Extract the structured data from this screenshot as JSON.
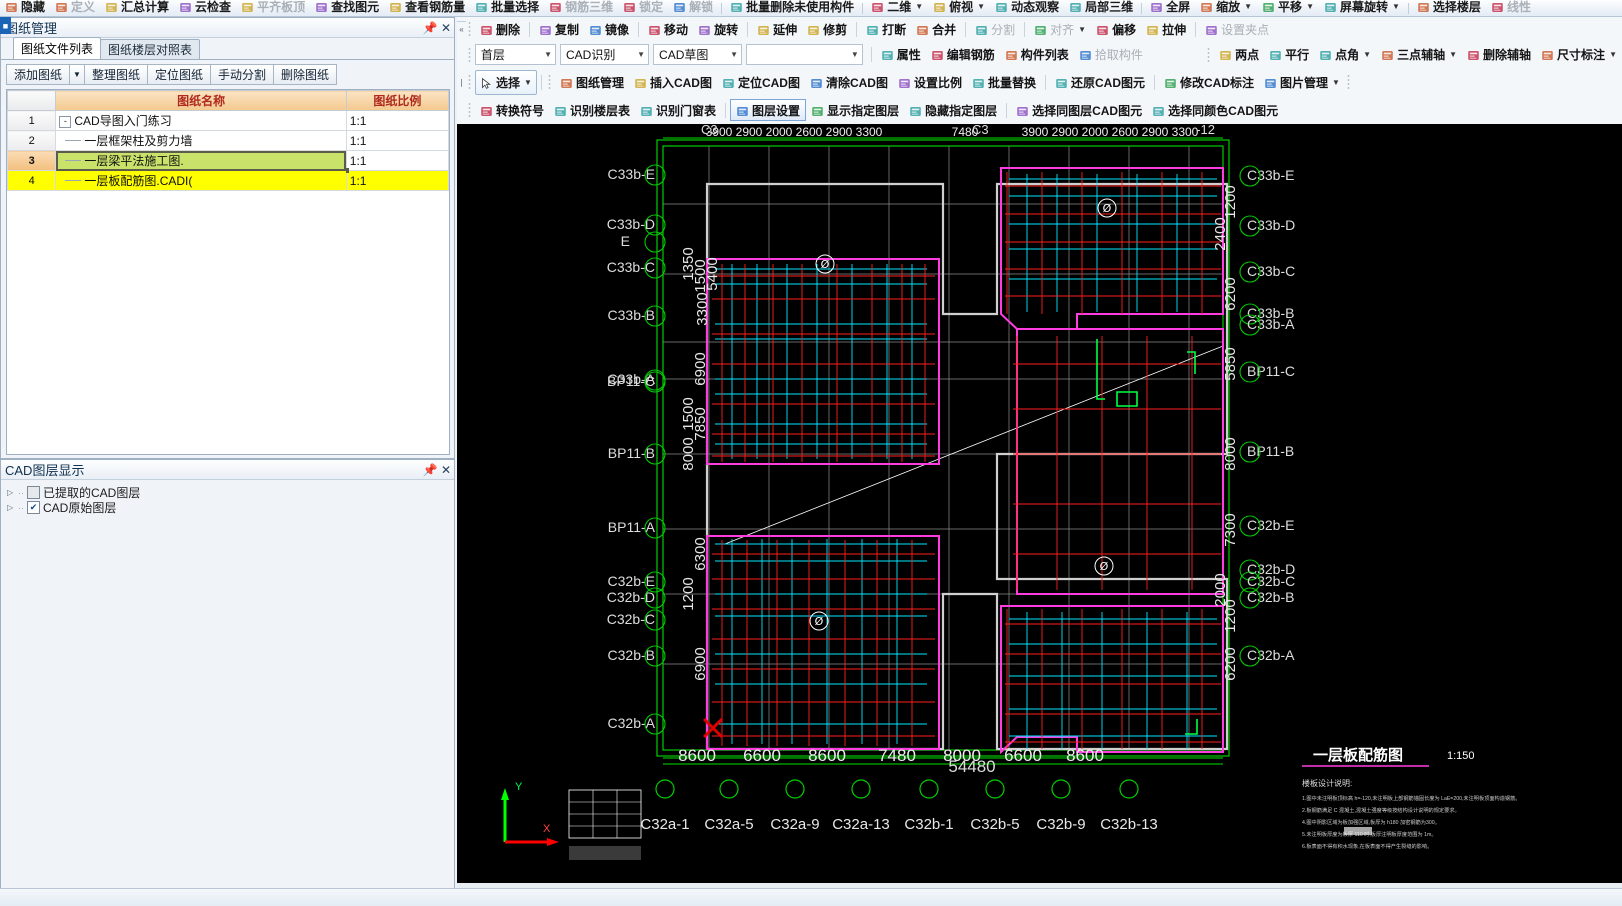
{
  "ribbon_top": {
    "items": [
      {
        "label": "隐藏",
        "icon": "eye-icon",
        "dim": false
      },
      {
        "label": "定义",
        "icon": "define-icon",
        "dim": true
      },
      {
        "label": "汇总计算",
        "icon": "sigma-icon",
        "dim": false
      },
      {
        "label": "云检查",
        "icon": "cloud-check-icon",
        "dim": false
      },
      {
        "label": "平齐板顶",
        "icon": "align-slab-icon",
        "dim": true
      },
      {
        "label": "查找图元",
        "icon": "find-element-icon",
        "dim": false
      },
      {
        "label": "查看钢筋量",
        "icon": "view-rebar-icon",
        "dim": false
      },
      {
        "label": "批量选择",
        "icon": "batch-select-icon",
        "dim": false
      },
      {
        "label": "钢筋三维",
        "icon": "rebar-3d-icon",
        "dim": true
      },
      {
        "label": "锁定",
        "icon": "lock-icon",
        "dim": true
      },
      {
        "label": "解锁",
        "icon": "unlock-icon",
        "dim": true
      },
      {
        "label": "批量删除未使用构件",
        "icon": "batch-delete-icon",
        "dim": false
      },
      {
        "label": "二维",
        "icon": "2d-view-icon",
        "dim": false,
        "caret": true
      },
      {
        "label": "俯视",
        "icon": "top-view-icon",
        "dim": false,
        "caret": true
      },
      {
        "label": "动态观察",
        "icon": "orbit-icon",
        "dim": false
      },
      {
        "label": "局部三维",
        "icon": "local-3d-icon",
        "dim": false
      },
      {
        "label": "全屏",
        "icon": "fullscreen-icon",
        "dim": false
      },
      {
        "label": "缩放",
        "icon": "zoom-icon",
        "dim": false,
        "caret": true
      },
      {
        "label": "平移",
        "icon": "pan-icon",
        "dim": false,
        "caret": true
      },
      {
        "label": "屏幕旋转",
        "icon": "screen-rotate-icon",
        "dim": false,
        "caret": true
      },
      {
        "label": "选择楼层",
        "icon": "select-floor-icon",
        "dim": false
      },
      {
        "label": "线性",
        "icon": "linear-icon",
        "dim": true
      }
    ]
  },
  "toolbar_edit": {
    "items": [
      {
        "label": "删除",
        "icon": "delete-icon"
      },
      {
        "label": "复制",
        "icon": "copy-icon"
      },
      {
        "label": "镜像",
        "icon": "mirror-icon"
      },
      {
        "label": "移动",
        "icon": "move-icon"
      },
      {
        "label": "旋转",
        "icon": "rotate-icon"
      },
      {
        "label": "延伸",
        "icon": "extend-icon"
      },
      {
        "label": "修剪",
        "icon": "trim-icon"
      },
      {
        "label": "打断",
        "icon": "break-icon"
      },
      {
        "label": "合并",
        "icon": "merge-icon"
      },
      {
        "label": "分割",
        "icon": "split-icon",
        "dim": true
      },
      {
        "label": "对齐",
        "icon": "align-icon",
        "caret": true,
        "dim": true
      },
      {
        "label": "偏移",
        "icon": "offset-icon"
      },
      {
        "label": "拉伸",
        "icon": "stretch-icon"
      },
      {
        "label": "设置夹点",
        "icon": "set-grip-icon",
        "dim": true
      }
    ]
  },
  "toolbar_props": {
    "combo_floor": "首层",
    "combo_recognize": "CAD识别",
    "combo_sketch": "CAD草图",
    "combo_blank": "",
    "items": [
      {
        "label": "属性",
        "icon": "properties-icon"
      },
      {
        "label": "编辑钢筋",
        "icon": "edit-rebar-icon"
      },
      {
        "label": "构件列表",
        "icon": "component-list-icon"
      },
      {
        "label": "拾取构件",
        "icon": "pick-component-icon",
        "dim": true
      }
    ],
    "axis_items": [
      {
        "label": "两点",
        "icon": "two-point-icon"
      },
      {
        "label": "平行",
        "icon": "parallel-icon"
      },
      {
        "label": "点角",
        "icon": "point-angle-icon",
        "caret": true
      },
      {
        "label": "三点辅轴",
        "icon": "three-point-axis-icon",
        "caret": true
      },
      {
        "label": "删除辅轴",
        "icon": "delete-axis-icon"
      },
      {
        "label": "尺寸标注",
        "icon": "dimension-icon",
        "caret": true
      }
    ]
  },
  "toolbar_cad": {
    "select_label": "选择",
    "items": [
      {
        "label": "图纸管理",
        "icon": "drawing-manager-icon"
      },
      {
        "label": "插入CAD图",
        "icon": "insert-cad-icon"
      },
      {
        "label": "定位CAD图",
        "icon": "locate-cad-icon"
      },
      {
        "label": "清除CAD图",
        "icon": "clear-cad-icon"
      },
      {
        "label": "设置比例",
        "icon": "set-scale-icon"
      },
      {
        "label": "批量替换",
        "icon": "batch-replace-icon"
      },
      {
        "label": "还原CAD图元",
        "icon": "restore-cad-icon"
      },
      {
        "label": "修改CAD标注",
        "icon": "modify-cad-dim-icon"
      },
      {
        "label": "图片管理",
        "icon": "image-manager-icon",
        "caret": true
      }
    ]
  },
  "toolbar_layer": {
    "items": [
      {
        "label": "转换符号",
        "icon": "convert-symbol-icon"
      },
      {
        "label": "识别楼层表",
        "icon": "recognize-floor-table-icon"
      },
      {
        "label": "识别门窗表",
        "icon": "recognize-window-table-icon"
      },
      {
        "label": "图层设置",
        "icon": "layer-settings-icon",
        "active": true
      },
      {
        "label": "显示指定图层",
        "icon": "show-layer-icon"
      },
      {
        "label": "隐藏指定图层",
        "icon": "hide-layer-icon"
      },
      {
        "label": "选择同图层CAD图元",
        "icon": "select-same-layer-icon"
      },
      {
        "label": "选择同颜色CAD图元",
        "icon": "select-same-color-icon"
      }
    ]
  },
  "drawing_manager": {
    "title": "图纸管理",
    "tabs": [
      {
        "label": "图纸文件列表",
        "active": true
      },
      {
        "label": "图纸楼层对照表",
        "active": false
      }
    ],
    "buttons": [
      {
        "label": "添加图纸",
        "dropdown": true
      },
      {
        "label": "整理图纸"
      },
      {
        "label": "定位图纸"
      },
      {
        "label": "手动分割"
      },
      {
        "label": "删除图纸"
      }
    ],
    "columns": [
      "",
      "图纸名称",
      "图纸比例"
    ],
    "rows": [
      {
        "n": "1",
        "name": "CAD导图入门练习",
        "scale": "1:1",
        "level": 0,
        "expander": "-",
        "highlight": "none"
      },
      {
        "n": "2",
        "name": "一层框架柱及剪力墙",
        "scale": "1:1",
        "level": 1,
        "expander": "",
        "highlight": "none"
      },
      {
        "n": "3",
        "name": "一层梁平法施工图.",
        "scale": "1:1",
        "level": 1,
        "expander": "",
        "highlight": "selected"
      },
      {
        "n": "4",
        "name": "一层板配筋图.CADI(",
        "scale": "1:1",
        "level": 1,
        "expander": "",
        "highlight": "yellow"
      }
    ]
  },
  "cad_layer_panel": {
    "title": "CAD图层显示",
    "nodes": [
      {
        "label": "已提取的CAD图层",
        "checked": false
      },
      {
        "label": "CAD原始图层",
        "checked": true
      }
    ]
  },
  "cad_drawing": {
    "title": "一层板配筋图",
    "scale": "1:150",
    "note_heading": "楼板设计说明:",
    "notes": [
      "1.图中未注明板顶标高 h=-120,未注明板上部钢筋锚固长度为 LaE=200,未注明板顶面构造钢筋。",
      "2.板钢筋满足 C 混凝土,混凝土强度等级按结构设计说明的规定要求。",
      "4.图中阴影区域为板加强区域,板厚为 h180 加密钢筋为300。",
      "5.未注明板厚度为板厚 110 时,板厚注明板厚度范围为 1m。",
      "6.板表面不得有积水现象,在板表面不得产生裂缝的影响。"
    ],
    "bottom_dims": [
      "8600",
      "6600",
      "8600",
      "7480",
      "8000",
      "6600",
      "8600"
    ],
    "bottom_total": "54480",
    "bottom_labels": [
      "C32a-1",
      "C32a-5",
      "C32a-9",
      "C32a-13",
      "C32b-1",
      "C32b-5",
      "C32b-9",
      "C32b-13"
    ],
    "top_dims_left": [
      "3900",
      "2900",
      "2000",
      "2600",
      "2900",
      "3300"
    ],
    "top_dims_mid": "7480",
    "top_dims_right": [
      "3900",
      "2900",
      "2000",
      "2600",
      "2900",
      "3300"
    ],
    "top_labels": [
      "C33b-12",
      "C33b-12"
    ],
    "left_axis_labels": [
      "E",
      "C33b-E",
      "C33b-D",
      "C33b-C",
      "C33b-B",
      "C33b-A",
      "BP11-C",
      "BP11-B",
      "BP11-A",
      "C32b-E",
      "C32b-D",
      "C32b-C",
      "C32b-B",
      "C32b-A"
    ],
    "right_axis_labels": [
      "C33b-E",
      "C33b-D",
      "C33b-C",
      "C33b-B",
      "C33b-A",
      "BP11-C",
      "BP11-B",
      "C32b-E",
      "C32b-D",
      "C32b-C",
      "C32b-B",
      "C32b-A"
    ],
    "vert_dims_left": [
      "1350",
      "1500",
      "5400",
      "3300",
      "6900",
      "1500",
      "7850",
      "8000",
      "6300",
      "1200",
      "6900"
    ],
    "vert_dims_right": [
      "1200",
      "2400",
      "6200",
      "5850",
      "8000",
      "7300",
      "2000",
      "1200",
      "6200"
    ],
    "axis_x_label": "X",
    "axis_y_label": "Y",
    "slab_marks": [
      "Ø",
      "Ø",
      "Ø",
      "Ø"
    ]
  }
}
